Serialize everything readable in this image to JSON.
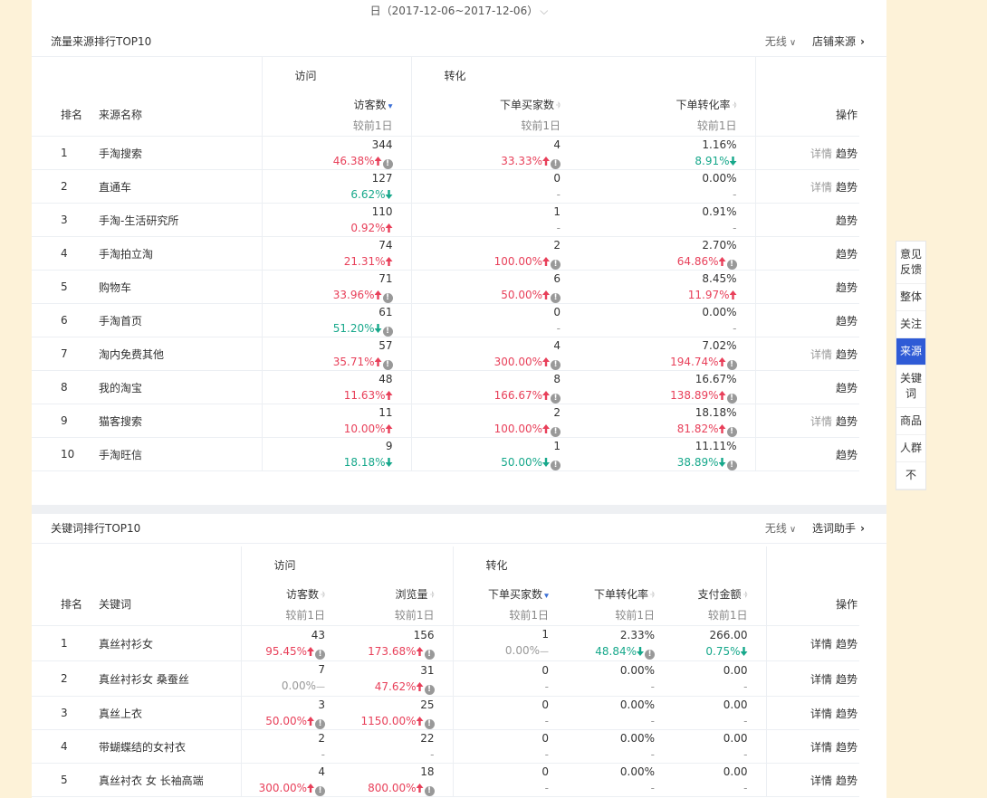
{
  "date_range": "日（2017-12-06~2017-12-06）",
  "colors": {
    "accent": "#2f5bd6",
    "up": "#e8405a",
    "down": "#17a88b"
  },
  "traffic": {
    "title": "流量来源排行TOP10",
    "device": "无线",
    "link": "店铺来源",
    "group_visit": "访问",
    "group_convert": "转化",
    "col_rank": "排名",
    "col_name": "来源名称",
    "col_visitors": "访客数",
    "col_buyers": "下单买家数",
    "col_rate": "下单转化率",
    "col_ops": "操作",
    "compare": "较前1日",
    "rows": [
      {
        "rank": "1",
        "name": "手淘搜索",
        "visitors": "344",
        "visitors_chg": "46.38%",
        "visitors_dir": "up",
        "visitors_info": true,
        "buyers": "4",
        "buyers_chg": "33.33%",
        "buyers_dir": "up",
        "buyers_info": true,
        "rate": "1.16%",
        "rate_chg": "8.91%",
        "rate_dir": "down",
        "rate_info": false,
        "detail": true
      },
      {
        "rank": "2",
        "name": "直通车",
        "visitors": "127",
        "visitors_chg": "6.62%",
        "visitors_dir": "down",
        "visitors_info": false,
        "buyers": "0",
        "buyers_chg": "-",
        "buyers_dir": "none",
        "buyers_info": false,
        "rate": "0.00%",
        "rate_chg": "-",
        "rate_dir": "none",
        "rate_info": false,
        "detail": true
      },
      {
        "rank": "3",
        "name": "手淘-生活研究所",
        "visitors": "110",
        "visitors_chg": "0.92%",
        "visitors_dir": "up",
        "visitors_info": false,
        "buyers": "1",
        "buyers_chg": "-",
        "buyers_dir": "none",
        "buyers_info": false,
        "rate": "0.91%",
        "rate_chg": "-",
        "rate_dir": "none",
        "rate_info": false,
        "detail": false
      },
      {
        "rank": "4",
        "name": "手淘拍立淘",
        "visitors": "74",
        "visitors_chg": "21.31%",
        "visitors_dir": "up",
        "visitors_info": false,
        "buyers": "2",
        "buyers_chg": "100.00%",
        "buyers_dir": "up",
        "buyers_info": true,
        "rate": "2.70%",
        "rate_chg": "64.86%",
        "rate_dir": "up",
        "rate_info": true,
        "detail": false
      },
      {
        "rank": "5",
        "name": "购物车",
        "visitors": "71",
        "visitors_chg": "33.96%",
        "visitors_dir": "up",
        "visitors_info": true,
        "buyers": "6",
        "buyers_chg": "50.00%",
        "buyers_dir": "up",
        "buyers_info": true,
        "rate": "8.45%",
        "rate_chg": "11.97%",
        "rate_dir": "up",
        "rate_info": false,
        "detail": false
      },
      {
        "rank": "6",
        "name": "手淘首页",
        "visitors": "61",
        "visitors_chg": "51.20%",
        "visitors_dir": "down",
        "visitors_info": true,
        "buyers": "0",
        "buyers_chg": "-",
        "buyers_dir": "none",
        "buyers_info": false,
        "rate": "0.00%",
        "rate_chg": "-",
        "rate_dir": "none",
        "rate_info": false,
        "detail": false
      },
      {
        "rank": "7",
        "name": "淘内免费其他",
        "visitors": "57",
        "visitors_chg": "35.71%",
        "visitors_dir": "up",
        "visitors_info": true,
        "buyers": "4",
        "buyers_chg": "300.00%",
        "buyers_dir": "up",
        "buyers_info": true,
        "rate": "7.02%",
        "rate_chg": "194.74%",
        "rate_dir": "up",
        "rate_info": true,
        "detail": true
      },
      {
        "rank": "8",
        "name": "我的淘宝",
        "visitors": "48",
        "visitors_chg": "11.63%",
        "visitors_dir": "up",
        "visitors_info": false,
        "buyers": "8",
        "buyers_chg": "166.67%",
        "buyers_dir": "up",
        "buyers_info": true,
        "rate": "16.67%",
        "rate_chg": "138.89%",
        "rate_dir": "up",
        "rate_info": true,
        "detail": false
      },
      {
        "rank": "9",
        "name": "猫客搜索",
        "visitors": "11",
        "visitors_chg": "10.00%",
        "visitors_dir": "up",
        "visitors_info": false,
        "buyers": "2",
        "buyers_chg": "100.00%",
        "buyers_dir": "up",
        "buyers_info": true,
        "rate": "18.18%",
        "rate_chg": "81.82%",
        "rate_dir": "up",
        "rate_info": true,
        "detail": true
      },
      {
        "rank": "10",
        "name": "手淘旺信",
        "visitors": "9",
        "visitors_chg": "18.18%",
        "visitors_dir": "down",
        "visitors_info": false,
        "buyers": "1",
        "buyers_chg": "50.00%",
        "buyers_dir": "down",
        "buyers_info": true,
        "rate": "11.11%",
        "rate_chg": "38.89%",
        "rate_dir": "down",
        "rate_info": true,
        "detail": false
      }
    ]
  },
  "keywords": {
    "title": "关键词排行TOP10",
    "device": "无线",
    "link": "选词助手",
    "group_visit": "访问",
    "group_convert": "转化",
    "col_rank": "排名",
    "col_name": "关键词",
    "col_visitors": "访客数",
    "col_views": "浏览量",
    "col_buyers": "下单买家数",
    "col_rate": "下单转化率",
    "col_pay": "支付金额",
    "col_ops": "操作",
    "compare": "较前1日",
    "rows": [
      {
        "rank": "1",
        "name": "真丝衬衫女",
        "visitors": "43",
        "visitors_chg": "95.45%",
        "visitors_dir": "up",
        "visitors_info": true,
        "views": "156",
        "views_chg": "173.68%",
        "views_dir": "up",
        "views_info": true,
        "buyers": "1",
        "buyers_chg": "0.00%",
        "buyers_dir": "flat",
        "buyers_info": false,
        "rate": "2.33%",
        "rate_chg": "48.84%",
        "rate_dir": "down",
        "rate_info": true,
        "pay": "266.00",
        "pay_chg": "0.75%",
        "pay_dir": "down",
        "pay_info": false
      },
      {
        "rank": "2",
        "name": "真丝衬衫女 桑蚕丝",
        "visitors": "7",
        "visitors_chg": "0.00%",
        "visitors_dir": "flat",
        "visitors_info": false,
        "views": "31",
        "views_chg": "47.62%",
        "views_dir": "up",
        "views_info": true,
        "buyers": "0",
        "buyers_chg": "-",
        "buyers_dir": "none",
        "buyers_info": false,
        "rate": "0.00%",
        "rate_chg": "-",
        "rate_dir": "none",
        "rate_info": false,
        "pay": "0.00",
        "pay_chg": "-",
        "pay_dir": "none",
        "pay_info": false
      },
      {
        "rank": "3",
        "name": "真丝上衣",
        "visitors": "3",
        "visitors_chg": "50.00%",
        "visitors_dir": "up",
        "visitors_info": true,
        "views": "25",
        "views_chg": "1150.00%",
        "views_dir": "up",
        "views_info": true,
        "buyers": "0",
        "buyers_chg": "-",
        "buyers_dir": "none",
        "buyers_info": false,
        "rate": "0.00%",
        "rate_chg": "-",
        "rate_dir": "none",
        "rate_info": false,
        "pay": "0.00",
        "pay_chg": "-",
        "pay_dir": "none",
        "pay_info": false
      },
      {
        "rank": "4",
        "name": "带蝴蝶结的女衬衣",
        "visitors": "2",
        "visitors_chg": "-",
        "visitors_dir": "none",
        "visitors_info": false,
        "views": "22",
        "views_chg": "-",
        "views_dir": "none",
        "views_info": false,
        "buyers": "0",
        "buyers_chg": "-",
        "buyers_dir": "none",
        "buyers_info": false,
        "rate": "0.00%",
        "rate_chg": "-",
        "rate_dir": "none",
        "rate_info": false,
        "pay": "0.00",
        "pay_chg": "-",
        "pay_dir": "none",
        "pay_info": false
      },
      {
        "rank": "5",
        "name": "真丝衬衣 女 长袖高端",
        "visitors": "4",
        "visitors_chg": "300.00%",
        "visitors_dir": "up",
        "visitors_info": true,
        "views": "18",
        "views_chg": "800.00%",
        "views_dir": "up",
        "views_info": true,
        "buyers": "0",
        "buyers_chg": "-",
        "buyers_dir": "none",
        "buyers_info": false,
        "rate": "0.00%",
        "rate_chg": "-",
        "rate_dir": "none",
        "rate_info": false,
        "pay": "0.00",
        "pay_chg": "-",
        "pay_dir": "none",
        "pay_info": false
      }
    ]
  },
  "ops": {
    "detail": "详情",
    "trend": "趋势",
    "info_glyph": "!"
  },
  "sidebar": [
    {
      "label": "意见反馈",
      "active": false
    },
    {
      "label": "整体",
      "active": false
    },
    {
      "label": "关注",
      "active": false
    },
    {
      "label": "来源",
      "active": true
    },
    {
      "label": "关键词",
      "active": false
    },
    {
      "label": "商品",
      "active": false
    },
    {
      "label": "人群",
      "active": false
    },
    {
      "label": "不",
      "active": false
    }
  ]
}
